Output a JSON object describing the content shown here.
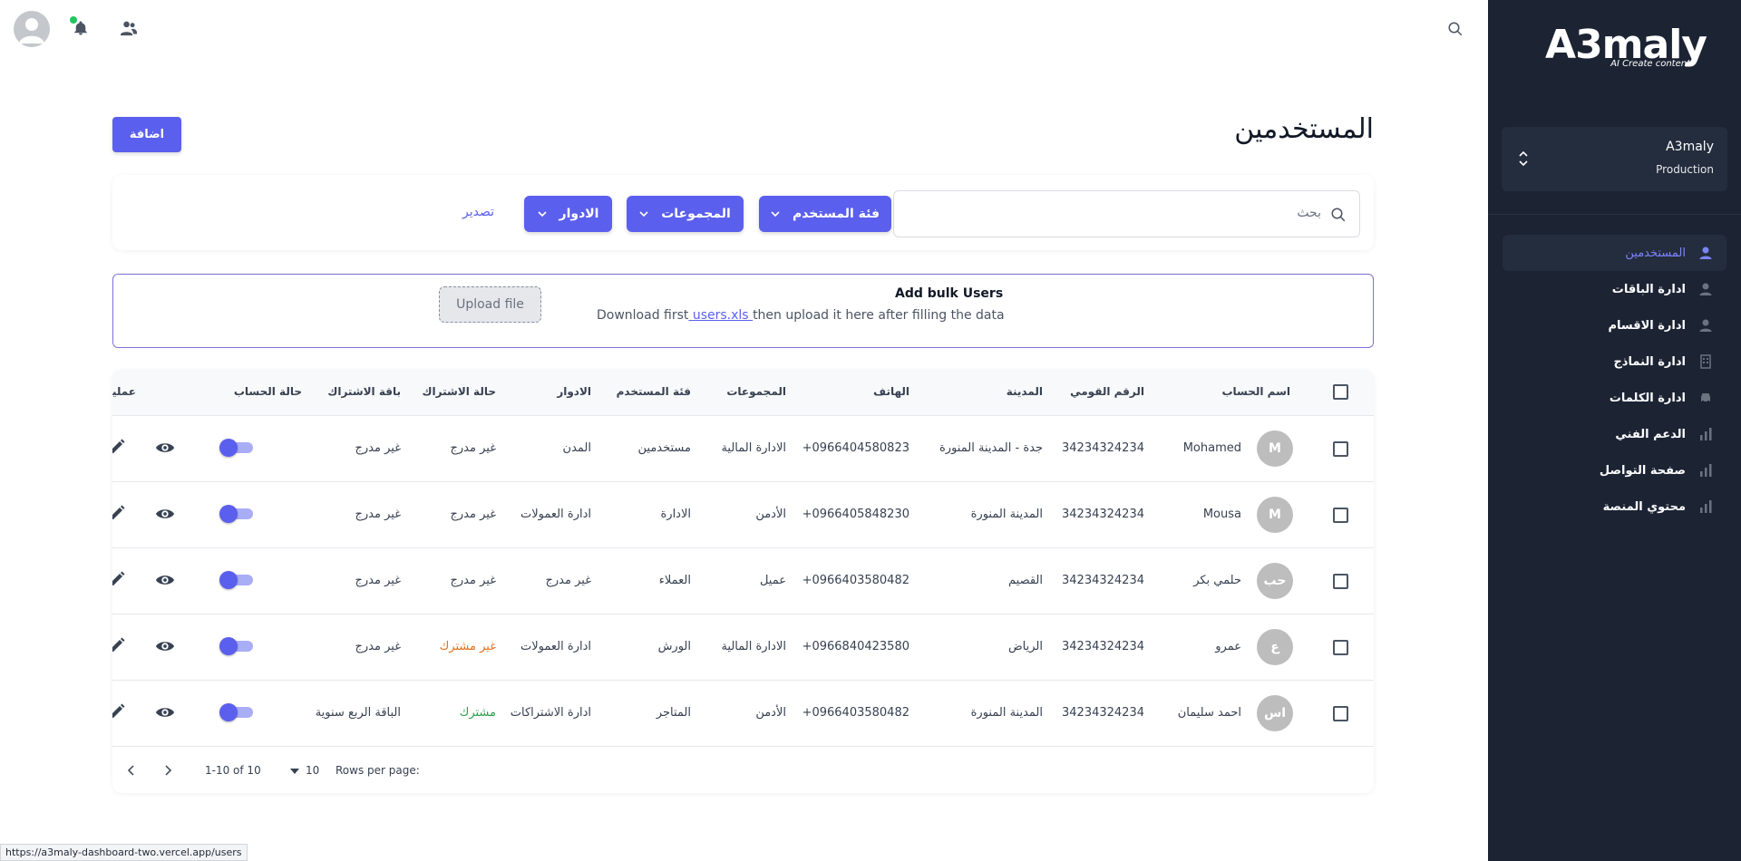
{
  "app": {
    "logo_text": "A3maly",
    "logo_tagline": "AI Create content"
  },
  "workspace": {
    "name": "A3maly",
    "env": "Production"
  },
  "sidebar": {
    "items": [
      {
        "label": "المستخدمين",
        "icon": "user-icon",
        "active": true
      },
      {
        "label": "ادارة الباقات",
        "icon": "user-icon"
      },
      {
        "label": "ادارة الاقسام",
        "icon": "user-icon"
      },
      {
        "label": "ادارة النماذج",
        "icon": "building-icon"
      },
      {
        "label": "ادارة الكلمات",
        "icon": "car-icon"
      },
      {
        "label": "الدعم الفني",
        "icon": "bar-chart-icon"
      },
      {
        "label": "صفحة التواصل",
        "icon": "bar-chart-icon"
      },
      {
        "label": "محتوي المنصة",
        "icon": "bar-chart-icon"
      }
    ]
  },
  "header": {
    "title": "المستخدمين",
    "add_label": "اضافة"
  },
  "filters": {
    "search_placeholder": "بحث",
    "user_category": "فئة المستخدم",
    "groups": "المجموعات",
    "roles": "الادوار",
    "export": "تصدير"
  },
  "bulk": {
    "title": "Add bulk Users",
    "desc_prefix": "Download first",
    "link": " users.xls ",
    "desc_suffix": "then upload it here after filling the data",
    "upload_label": "Upload file"
  },
  "table": {
    "headers": {
      "name": "اسم الحساب",
      "national_id": "الرقم القومي",
      "city": "المدينة",
      "phone": "الهاتف",
      "groups": "المجموعات",
      "category": "فئة المستخدم",
      "roles": "الادوار",
      "sub_status": "حالة الاشتراك",
      "package": "باقة الاشتراك",
      "account_status": "حالة الحساب",
      "actions": "عمليا"
    },
    "rows": [
      {
        "initials": "M",
        "name": "Mohamed",
        "national_id": "34234324234",
        "city": "جدة - المدينة المنورة",
        "phone": "+0966404580823",
        "groups": "الادارة المالية",
        "category": "مستخدمين",
        "roles": "المدن",
        "sub_status": "غير مدرج",
        "sub_color": "",
        "package": "غير مدرج"
      },
      {
        "initials": "M",
        "name": "Mousa",
        "national_id": "34234324234",
        "city": "المدينة المنورة",
        "phone": "+0966405848230",
        "groups": "الأدمن",
        "category": "الادارة",
        "roles": "ادارة العمولات",
        "sub_status": "غير مدرج",
        "sub_color": "",
        "package": "غير مدرج"
      },
      {
        "initials": "حب",
        "name": "حلمي بكر",
        "national_id": "34234324234",
        "city": "القصيم",
        "phone": "+0966403580482",
        "groups": "عميل",
        "category": "العملاء",
        "roles": "غير مدرج",
        "sub_status": "غير مدرج",
        "sub_color": "",
        "package": "غير مدرج"
      },
      {
        "initials": "ع",
        "name": "عمرو",
        "national_id": "34234324234",
        "city": "الرياض",
        "phone": "+0966840423580",
        "groups": "الادارة المالية",
        "category": "الورش",
        "roles": "ادارة العمولات",
        "sub_status": "غير مشترك",
        "sub_color": "#e0701c",
        "package": "غير مدرج"
      },
      {
        "initials": "اس",
        "name": "احمد سليمان",
        "national_id": "34234324234",
        "city": "المدينة المنورة",
        "phone": "+0966403580482",
        "groups": "الأدمن",
        "category": "المتاجر",
        "roles": "ادارة الاشتراكات",
        "sub_status": "مشترك",
        "sub_color": "#2e9e4d",
        "package": "الباقة الربع سنوية"
      }
    ]
  },
  "pagination": {
    "rows_per_page_label": "Rows per page:",
    "rows_per_page": "10",
    "range": "1-10 of 10"
  },
  "status_url": "https://a3maly-dashboard-two.vercel.app/users",
  "colors": {
    "accent": "#5b5fed",
    "sidebar_bg": "#1c2434"
  }
}
